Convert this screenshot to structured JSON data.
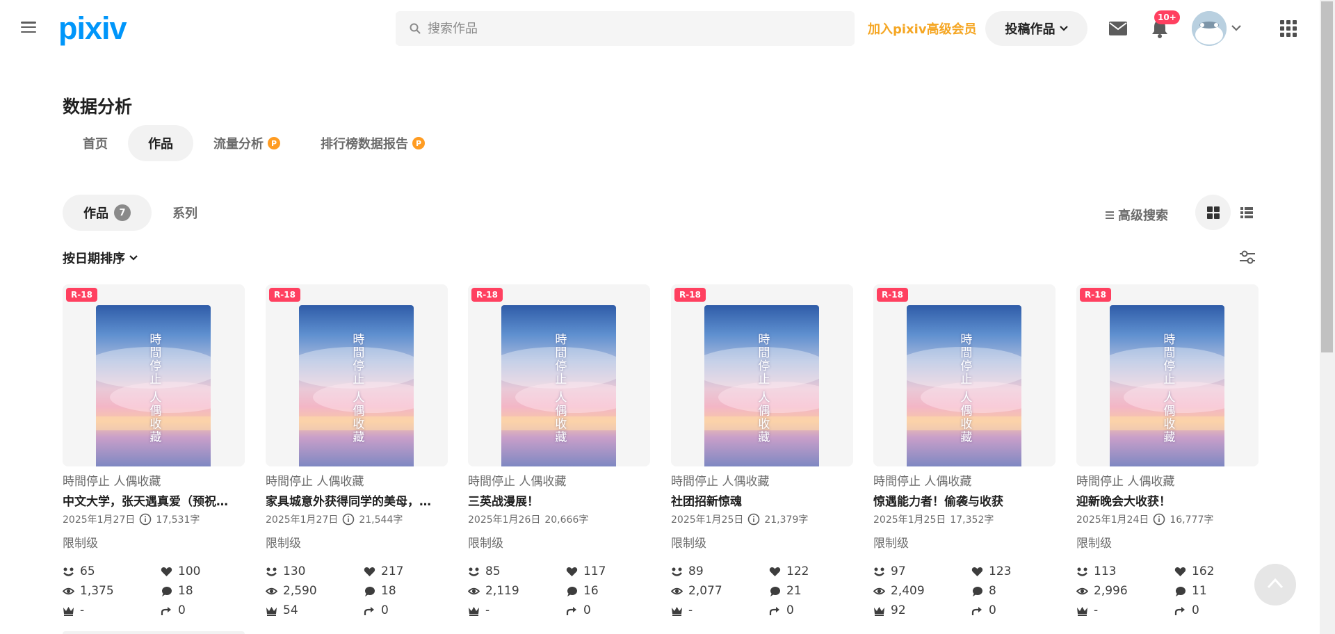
{
  "header": {
    "logo": "pixiv",
    "search_placeholder": "搜索作品",
    "premium_link": "加入pixiv高级会员",
    "post_button": "投稿作品",
    "notification_badge": "10+"
  },
  "page": {
    "title": "数据分析",
    "nav_tabs": [
      {
        "label": "首页"
      },
      {
        "label": "作品"
      },
      {
        "label": "流量分析"
      },
      {
        "label": "排行榜数据报告"
      }
    ],
    "sub_tabs": [
      {
        "label": "作品",
        "count": "7"
      },
      {
        "label": "系列"
      }
    ],
    "advanced_search": "高级搜索",
    "sort_label": "按日期排序"
  },
  "cards": [
    {
      "badge": "R-18",
      "cover_title": "時間停止 人偶收藏",
      "series": "時間停止 人偶收藏",
      "title": "中文大学，张天遇真爱（预祝…",
      "date": "2025年1月27日",
      "chars": "17,531字",
      "rating": "限制级",
      "stats": {
        "followers": "65",
        "likes": "100",
        "views": "1,375",
        "comments": "18",
        "rank": "-",
        "shares": "0"
      }
    },
    {
      "badge": "R-18",
      "cover_title": "時間停止 人偶收藏",
      "series": "時間停止 人偶收藏",
      "title": "家具城意外获得同学的美母，…",
      "date": "2025年1月27日",
      "chars": "21,544字",
      "rating": "限制级",
      "stats": {
        "followers": "130",
        "likes": "217",
        "views": "2,590",
        "comments": "18",
        "rank": "54",
        "shares": "0"
      }
    },
    {
      "badge": "R-18",
      "cover_title": "時間停止 人偶收藏",
      "series": "時間停止 人偶收藏",
      "title": "三英战漫展！",
      "date": "2025年1月26日",
      "chars": "20,666字",
      "rating": "限制级",
      "stats": {
        "followers": "85",
        "likes": "117",
        "views": "2,119",
        "comments": "16",
        "rank": "-",
        "shares": "0"
      }
    },
    {
      "badge": "R-18",
      "cover_title": "時間停止 人偶收藏",
      "series": "時間停止 人偶收藏",
      "title": "社团招新惊魂",
      "date": "2025年1月25日",
      "chars": "21,379字",
      "rating": "限制级",
      "stats": {
        "followers": "89",
        "likes": "122",
        "views": "2,077",
        "comments": "21",
        "rank": "-",
        "shares": "0"
      }
    },
    {
      "badge": "R-18",
      "cover_title": "時間停止 人偶收藏",
      "series": "時間停止 人偶收藏",
      "title": "惊遇能力者！偷袭与收获",
      "date": "2025年1月25日",
      "chars": "17,352字",
      "rating": "限制级",
      "stats": {
        "followers": "97",
        "likes": "123",
        "views": "2,409",
        "comments": "8",
        "rank": "92",
        "shares": "0"
      }
    },
    {
      "badge": "R-18",
      "cover_title": "時間停止 人偶收藏",
      "series": "時間停止 人偶收藏",
      "title": "迎新晚会大收获！",
      "date": "2025年1月24日",
      "chars": "16,777字",
      "rating": "限制级",
      "stats": {
        "followers": "113",
        "likes": "162",
        "views": "2,996",
        "comments": "11",
        "rank": "-",
        "shares": "0"
      }
    }
  ],
  "colors": {
    "brand": "#0096fa",
    "premium": "#f5a623",
    "r18_badge": "#ff4060",
    "notification": "#ff4060",
    "p_badge": "#ff9c22"
  },
  "icons": [
    "hamburger-icon",
    "search-icon",
    "chevron-down-icon",
    "mail-icon",
    "bell-icon",
    "grid-view-icon",
    "list-view-icon",
    "filter-icon",
    "info-icon",
    "followers-icon",
    "heart-icon",
    "eye-icon",
    "comment-icon",
    "crown-icon",
    "share-icon",
    "arrow-up-icon",
    "apps-icon"
  ]
}
